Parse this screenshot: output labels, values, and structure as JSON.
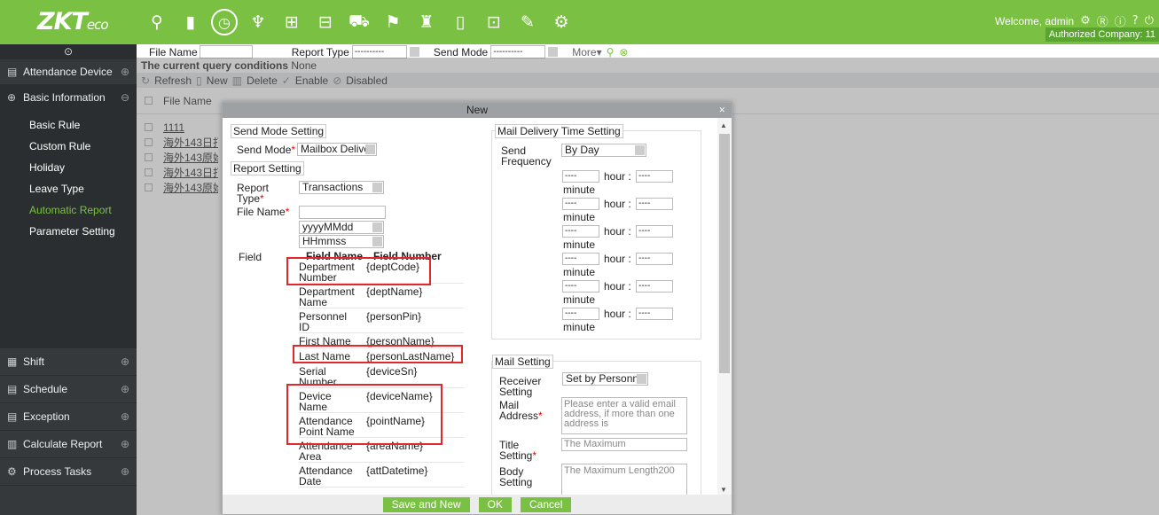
{
  "header": {
    "logo_main": "ZKT",
    "logo_sub": "eco",
    "nav_icons": [
      "person-icon",
      "door-icon",
      "clock-icon",
      "elevator-icon",
      "visitor-icon",
      "consumption-icon",
      "parking-icon",
      "patrol-icon",
      "building-icon",
      "locker-icon",
      "face-icon",
      "signature-icon",
      "settings-icon"
    ],
    "welcome": "Welcome, admin",
    "company": "Authorized Company: 11"
  },
  "sidebar": {
    "collapse_glyph": "⊙",
    "sections": [
      {
        "label": "Attendance Device",
        "glyph": "⊕"
      },
      {
        "label": "Basic Information",
        "glyph": "⊖"
      }
    ],
    "items": [
      {
        "label": "Basic Rule"
      },
      {
        "label": "Custom Rule"
      },
      {
        "label": "Holiday"
      },
      {
        "label": "Leave Type"
      },
      {
        "label": "Automatic Report"
      },
      {
        "label": "Parameter Setting"
      }
    ],
    "lower_sections": [
      {
        "label": "Shift",
        "glyph": "⊕"
      },
      {
        "label": "Schedule",
        "glyph": "⊕"
      },
      {
        "label": "Exception",
        "glyph": "⊕"
      },
      {
        "label": "Calculate Report",
        "glyph": "⊕"
      },
      {
        "label": "Process Tasks",
        "glyph": "⊕"
      }
    ]
  },
  "filter": {
    "file_name_label": "File Name",
    "report_type_label": "Report Type",
    "report_type_value": "----------",
    "send_mode_label": "Send Mode",
    "send_mode_value": "----------",
    "more_label": "More▾"
  },
  "query": {
    "prefix": "The current query conditions",
    "value": "None"
  },
  "toolbar": {
    "refresh": "Refresh",
    "new": "New",
    "delete": "Delete",
    "enable": "Enable",
    "disabled": "Disabled"
  },
  "table": {
    "column_file_name": "File Name",
    "rows": [
      "1111",
      "海外143日打",
      "海外143原始",
      "海外143日打",
      "海外143原始"
    ]
  },
  "dialog": {
    "title": "New",
    "send_mode_legend": "Send Mode Setting",
    "send_mode_label": "Send Mode",
    "send_mode_value": "Mailbox Deliver",
    "report_legend": "Report Setting",
    "report_type_label1": "Report",
    "report_type_label2": "Type",
    "report_type_value": "Transactions",
    "file_name_label": "File Name",
    "date_format": "yyyyMMdd",
    "time_format": "HHmmss",
    "field_label": "Field",
    "col_field_name": "Field Name",
    "col_field_number": "Field Number",
    "fields": [
      {
        "name1": "Department",
        "name2": "Number",
        "code": "{deptCode}"
      },
      {
        "name1": "Department",
        "name2": "Name",
        "code": "{deptName}"
      },
      {
        "name1": "Personnel",
        "name2": "ID",
        "code": "{personPin}"
      },
      {
        "name1": "First Name",
        "name2": "",
        "code": "{personName}"
      },
      {
        "name1": "Last Name",
        "name2": "",
        "code": "{personLastName}"
      },
      {
        "name1": "Serial",
        "name2": "Number",
        "code": "{deviceSn}"
      },
      {
        "name1": "Device",
        "name2": "Name",
        "code": "{deviceName}"
      },
      {
        "name1": "Attendance",
        "name2": "Point Name",
        "code": "{pointName}"
      },
      {
        "name1": "Attendance",
        "name2": "Area",
        "code": "{areaName}"
      },
      {
        "name1": "Attendance",
        "name2": "Date",
        "code": "{attDatetime}"
      }
    ],
    "mail_time_legend": "Mail Delivery Time Setting",
    "send_freq_label1": "Send",
    "send_freq_label2": "Frequency",
    "send_freq_value": "By Day",
    "time_rows": [
      {
        "hour": "----",
        "hour_label": "hour :",
        "minute": "----",
        "minute_label": "minute"
      },
      {
        "hour": "----",
        "hour_label": "hour :",
        "minute": "----",
        "minute_label": "minute"
      },
      {
        "hour": "----",
        "hour_label": "hour :",
        "minute": "----",
        "minute_label": "minute"
      },
      {
        "hour": "----",
        "hour_label": "hour :",
        "minute": "----",
        "minute_label": "minute"
      },
      {
        "hour": "----",
        "hour_label": "hour :",
        "minute": "----",
        "minute_label": "minute"
      },
      {
        "hour": "----",
        "hour_label": "hour :",
        "minute": "----",
        "minute_label": "minute"
      }
    ],
    "mail_legend": "Mail Setting",
    "receiver_label1": "Receiver",
    "receiver_label2": "Setting",
    "receiver_value": "Set by Personne",
    "mail_address_label1": "Mail",
    "mail_address_label2": "Address",
    "mail_address_placeholder": "Please enter a valid email address, if more than one address is",
    "title_label1": "Title",
    "title_label2": "Setting",
    "title_placeholder": "The Maximum",
    "body_label1": "Body",
    "body_label2": "Setting",
    "body_placeholder": "The Maximum Length200",
    "buttons": {
      "save_new": "Save and New",
      "ok": "OK",
      "cancel": "Cancel"
    }
  }
}
